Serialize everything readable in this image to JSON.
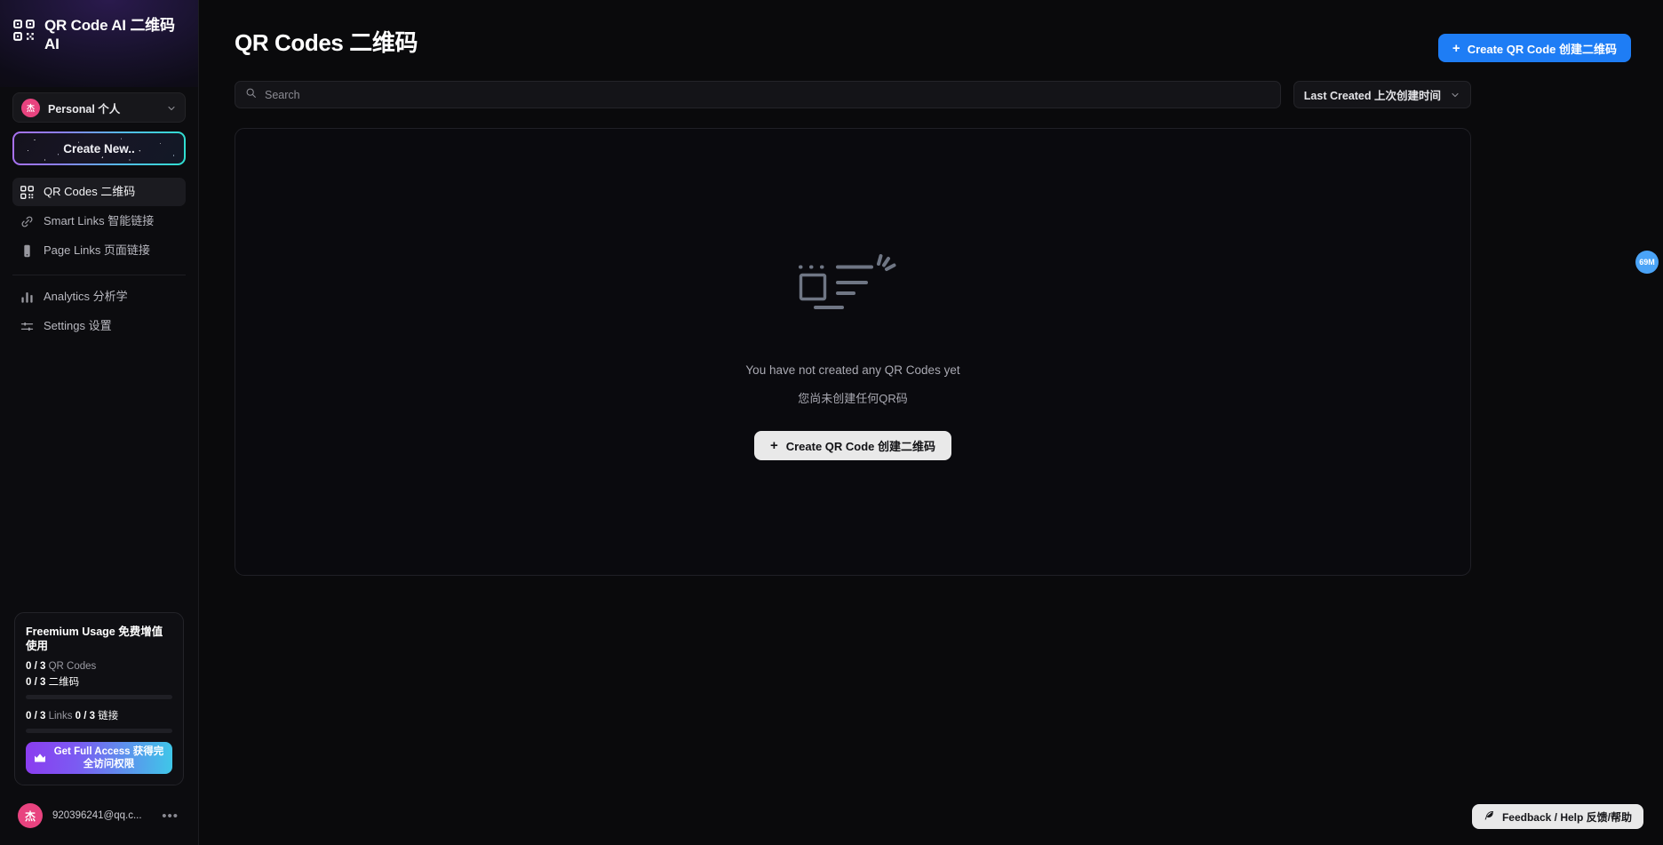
{
  "brand": {
    "title": "QR Code AI 二维码AI",
    "icon": "qr-code-icon"
  },
  "sidebar": {
    "org": {
      "avatar_char": "杰",
      "name": "Personal 个人",
      "chevron": "chevron-down-icon"
    },
    "create_new_label": "Create New..",
    "items": [
      {
        "label": "QR Codes 二维码",
        "icon": "qr-code-icon",
        "active": true
      },
      {
        "label": "Smart Links 智能链接",
        "icon": "link-icon",
        "active": false
      },
      {
        "label": "Page Links 页面链接",
        "icon": "mobile-icon",
        "active": false
      }
    ],
    "items2": [
      {
        "label": "Analytics 分析学",
        "icon": "bar-chart-icon",
        "active": false
      },
      {
        "label": "Settings 设置",
        "icon": "sliders-icon",
        "active": false
      }
    ],
    "usage": {
      "title": "Freemium Usage 免费增值使用",
      "qr_count": "0 / 3",
      "qr_label_en": "QR Codes",
      "qr_count_zh": "0 / 3",
      "qr_label_zh": "二维码",
      "links_count": "0 / 3",
      "links_label_en": "Links",
      "links_count_zh": "0 / 3",
      "links_label_zh": "链接",
      "upgrade_label": "Get Full Access 获得完全访问权限",
      "upgrade_icon": "crown-icon"
    },
    "user": {
      "avatar_char": "杰",
      "email": "920396241@qq.c...",
      "more": "•••"
    }
  },
  "main": {
    "page_title": "QR Codes 二维码",
    "create_button": "Create QR Code 创建二维码",
    "create_button_plus": "+",
    "search": {
      "placeholder": "Search",
      "value": "",
      "icon": "search-icon"
    },
    "sort": {
      "label": "Last Created 上次创建时间",
      "chevron": "chevron-down-icon"
    },
    "empty_state": {
      "illustration": "empty-qr-illustration",
      "message_en": "You have not created any QR Codes yet",
      "message_zh": "您尚未创建任何QR码",
      "cta_label": "Create QR Code 创建二维码",
      "cta_plus": "+"
    }
  },
  "overlays": {
    "side_badge": "69M",
    "feedback_label": "Feedback / Help 反馈/帮助",
    "feedback_icon": "feather-icon"
  },
  "colors": {
    "accent_blue": "#1e7df5",
    "badge_blue": "#4aa3f7",
    "avatar_pink": "#e8437f",
    "gradient_start": "#8b3df0",
    "gradient_end": "#3fc7e8"
  }
}
